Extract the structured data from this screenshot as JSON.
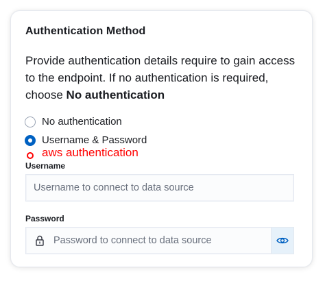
{
  "auth": {
    "title": "Authentication Method",
    "description_prefix": "Provide authentication details require to gain access to the endpoint. If no authentication is required, choose ",
    "description_bold": "No authentication",
    "options": [
      {
        "label": "No authentication",
        "selected": false
      },
      {
        "label": "Username & Password",
        "selected": true
      },
      {
        "label": "aws authentication",
        "selected": false
      }
    ]
  },
  "username": {
    "label": "Username",
    "placeholder": "Username to connect to data source",
    "value": ""
  },
  "password": {
    "label": "Password",
    "placeholder": "Password to connect to data source",
    "value": "",
    "prepend_icon": "lock-icon",
    "append_icon": "eye-icon"
  },
  "colors": {
    "accent": "#0061c2",
    "annotation": "#ff0000",
    "eye_button_bg": "#e6f1fa"
  }
}
